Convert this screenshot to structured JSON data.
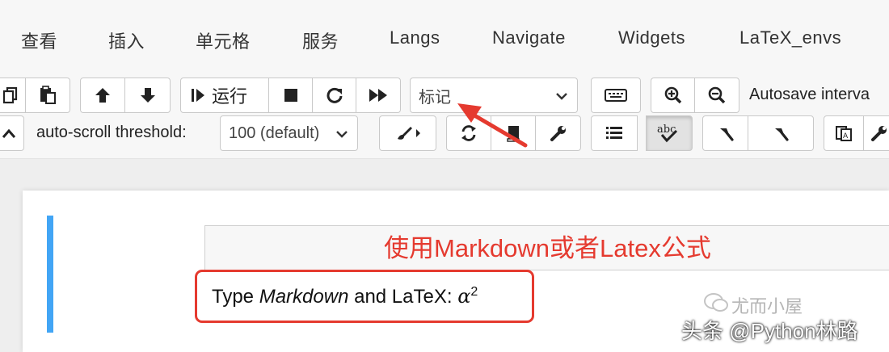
{
  "menu": {
    "items": [
      "查看",
      "插入",
      "单元格",
      "服务",
      "Langs",
      "Navigate",
      "Widgets",
      "LaTeX_envs"
    ]
  },
  "toolbar": {
    "run_label": "运行",
    "cell_type": "标记",
    "autosave_label": "Autosave interva",
    "autoscroll_label": "auto-scroll threshold:",
    "autoscroll_value": "100 (default)"
  },
  "icons": [
    "copy-icon",
    "paste-icon",
    "arrow-up-icon",
    "arrow-down-icon",
    "step-run-icon",
    "stop-icon",
    "restart-icon",
    "fast-forward-icon",
    "chevron-down-icon",
    "keyboard-icon",
    "zoom-in-icon",
    "zoom-out-icon",
    "caret-up-icon",
    "paint-brush-icon",
    "refresh-icon",
    "notebook-icon",
    "wrench-icon",
    "list-icon",
    "spellcheck-icon",
    "hammer-icon",
    "translate-icon"
  ],
  "cell": {
    "annotation": "使用Markdown或者Latex公式",
    "rendered": {
      "prefix": "Type ",
      "em": "Markdown",
      "middle": " and LaTeX: ",
      "math": "α",
      "sup": "2"
    }
  },
  "watermark": {
    "wechat": "尤而小屋",
    "credit": "头条 @Python林路"
  },
  "colors": {
    "accent_blue": "#42a5f5",
    "annotation_red": "#e53a2f"
  }
}
